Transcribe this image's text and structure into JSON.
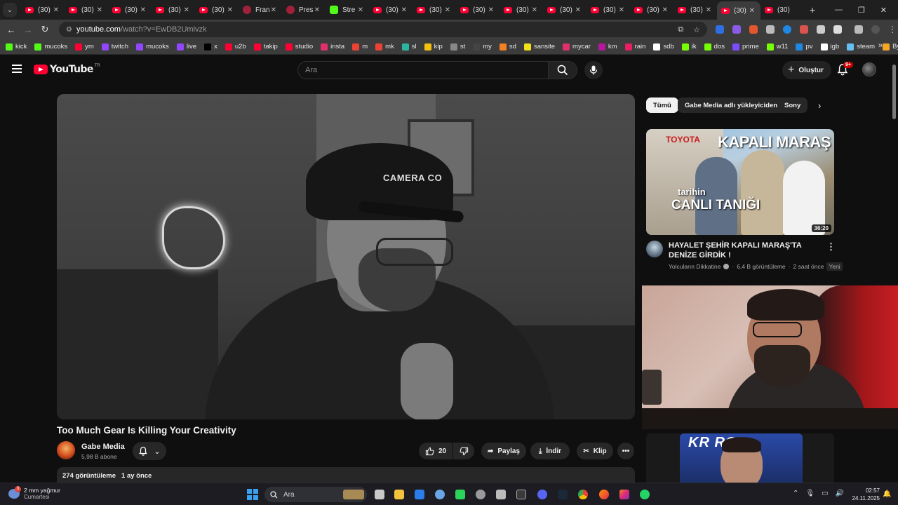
{
  "tabs": {
    "items": [
      {
        "label": "(30)"
      },
      {
        "label": "(30)"
      },
      {
        "label": "(30)"
      },
      {
        "label": "(30)"
      },
      {
        "label": "(30)"
      },
      {
        "label": "Fran"
      },
      {
        "label": "Pres"
      },
      {
        "label": "Stre"
      },
      {
        "label": "(30)"
      },
      {
        "label": "(30)"
      },
      {
        "label": "(30)"
      },
      {
        "label": "(30)"
      },
      {
        "label": "(30)"
      },
      {
        "label": "(30)"
      },
      {
        "label": "(30)"
      },
      {
        "label": "(30)"
      },
      {
        "label": "(30)"
      },
      {
        "label": "(30)"
      }
    ],
    "new_tab": "+"
  },
  "address": {
    "host": "youtube.com",
    "path": "/watch?v=EwDB2Umivzk"
  },
  "bookmarks": [
    {
      "label": "kick",
      "color": "#53fc18"
    },
    {
      "label": "mucoks",
      "color": "#53fc18"
    },
    {
      "label": "ym",
      "color": "#ff0033"
    },
    {
      "label": "twitch",
      "color": "#9146ff"
    },
    {
      "label": "mucoks",
      "color": "#9146ff"
    },
    {
      "label": "live",
      "color": "#9146ff"
    },
    {
      "label": "x",
      "color": "#000000"
    },
    {
      "label": "u2b",
      "color": "#ff0033"
    },
    {
      "label": "takip",
      "color": "#ff0033"
    },
    {
      "label": "studio",
      "color": "#ff0033"
    },
    {
      "label": "insta",
      "color": "#e1306c"
    },
    {
      "label": "m",
      "color": "#ea4335"
    },
    {
      "label": "mk",
      "color": "#ea4335"
    },
    {
      "label": "sl",
      "color": "#2bb5a0"
    },
    {
      "label": "kip",
      "color": "#f4c20d"
    },
    {
      "label": "st",
      "color": "#888888"
    },
    {
      "label": "my",
      "color": "#444444"
    },
    {
      "label": "sd",
      "color": "#f48024"
    },
    {
      "label": "sansite",
      "color": "#f4e01a"
    },
    {
      "label": "mycar",
      "color": "#e1306c"
    },
    {
      "label": "km",
      "color": "#b5179e"
    },
    {
      "label": "rain",
      "color": "#e91e63"
    },
    {
      "label": "sdb",
      "color": "#ffffff"
    },
    {
      "label": "ik",
      "color": "#76ff03"
    },
    {
      "label": "dos",
      "color": "#76ff03"
    },
    {
      "label": "prime",
      "color": "#7c4dff"
    },
    {
      "label": "w11",
      "color": "#76ff03"
    },
    {
      "label": "pv",
      "color": "#1e88e5"
    },
    {
      "label": "igb",
      "color": "#ffffff"
    },
    {
      "label": "steam",
      "color": "#66c0f4"
    },
    {
      "label": "ByNo",
      "color": "#f5a623"
    }
  ],
  "header": {
    "logo": "YouTube",
    "country": "TR",
    "search_placeholder": "Ara",
    "create_label": "Oluştur",
    "notif_count": "9+"
  },
  "video": {
    "title": "Too Much Gear Is Killing Your Creativity",
    "cap_text": "CAMERA CO",
    "channel": "Gabe Media",
    "subs": "5,98 B abone",
    "likes": "20",
    "share": "Paylaş",
    "download": "İndir",
    "clip": "Klip",
    "views": "274 görüntüleme",
    "ago": "1 ay önce"
  },
  "chips": [
    "Tümü",
    "Gabe Media adlı yükleyiciden",
    "Sony"
  ],
  "rec": {
    "thumb_brand": "TOYOTA",
    "thumb_headline": "KAPALI MARAŞ",
    "thumb_sub1": "tarihin",
    "thumb_sub2": "CANLI TANIĞI",
    "duration": "36:20",
    "title": "HAYALET ŞEHİR KAPALI MARAŞ'TA DENİZE GİRDİK !",
    "channel": "Yolcuların Dikkatine",
    "views": "6,4 B görüntüleme",
    "ago": "2 saat önce",
    "badge": "Yeni"
  },
  "rec2": {
    "thumb_text": "KR ROP"
  },
  "taskbar": {
    "weather_temp": "2 mm yağmur",
    "weather_day": "Cumartesi",
    "weather_badge": "3",
    "search": "Ara",
    "time": "02:57",
    "date": "24.11.2025"
  }
}
